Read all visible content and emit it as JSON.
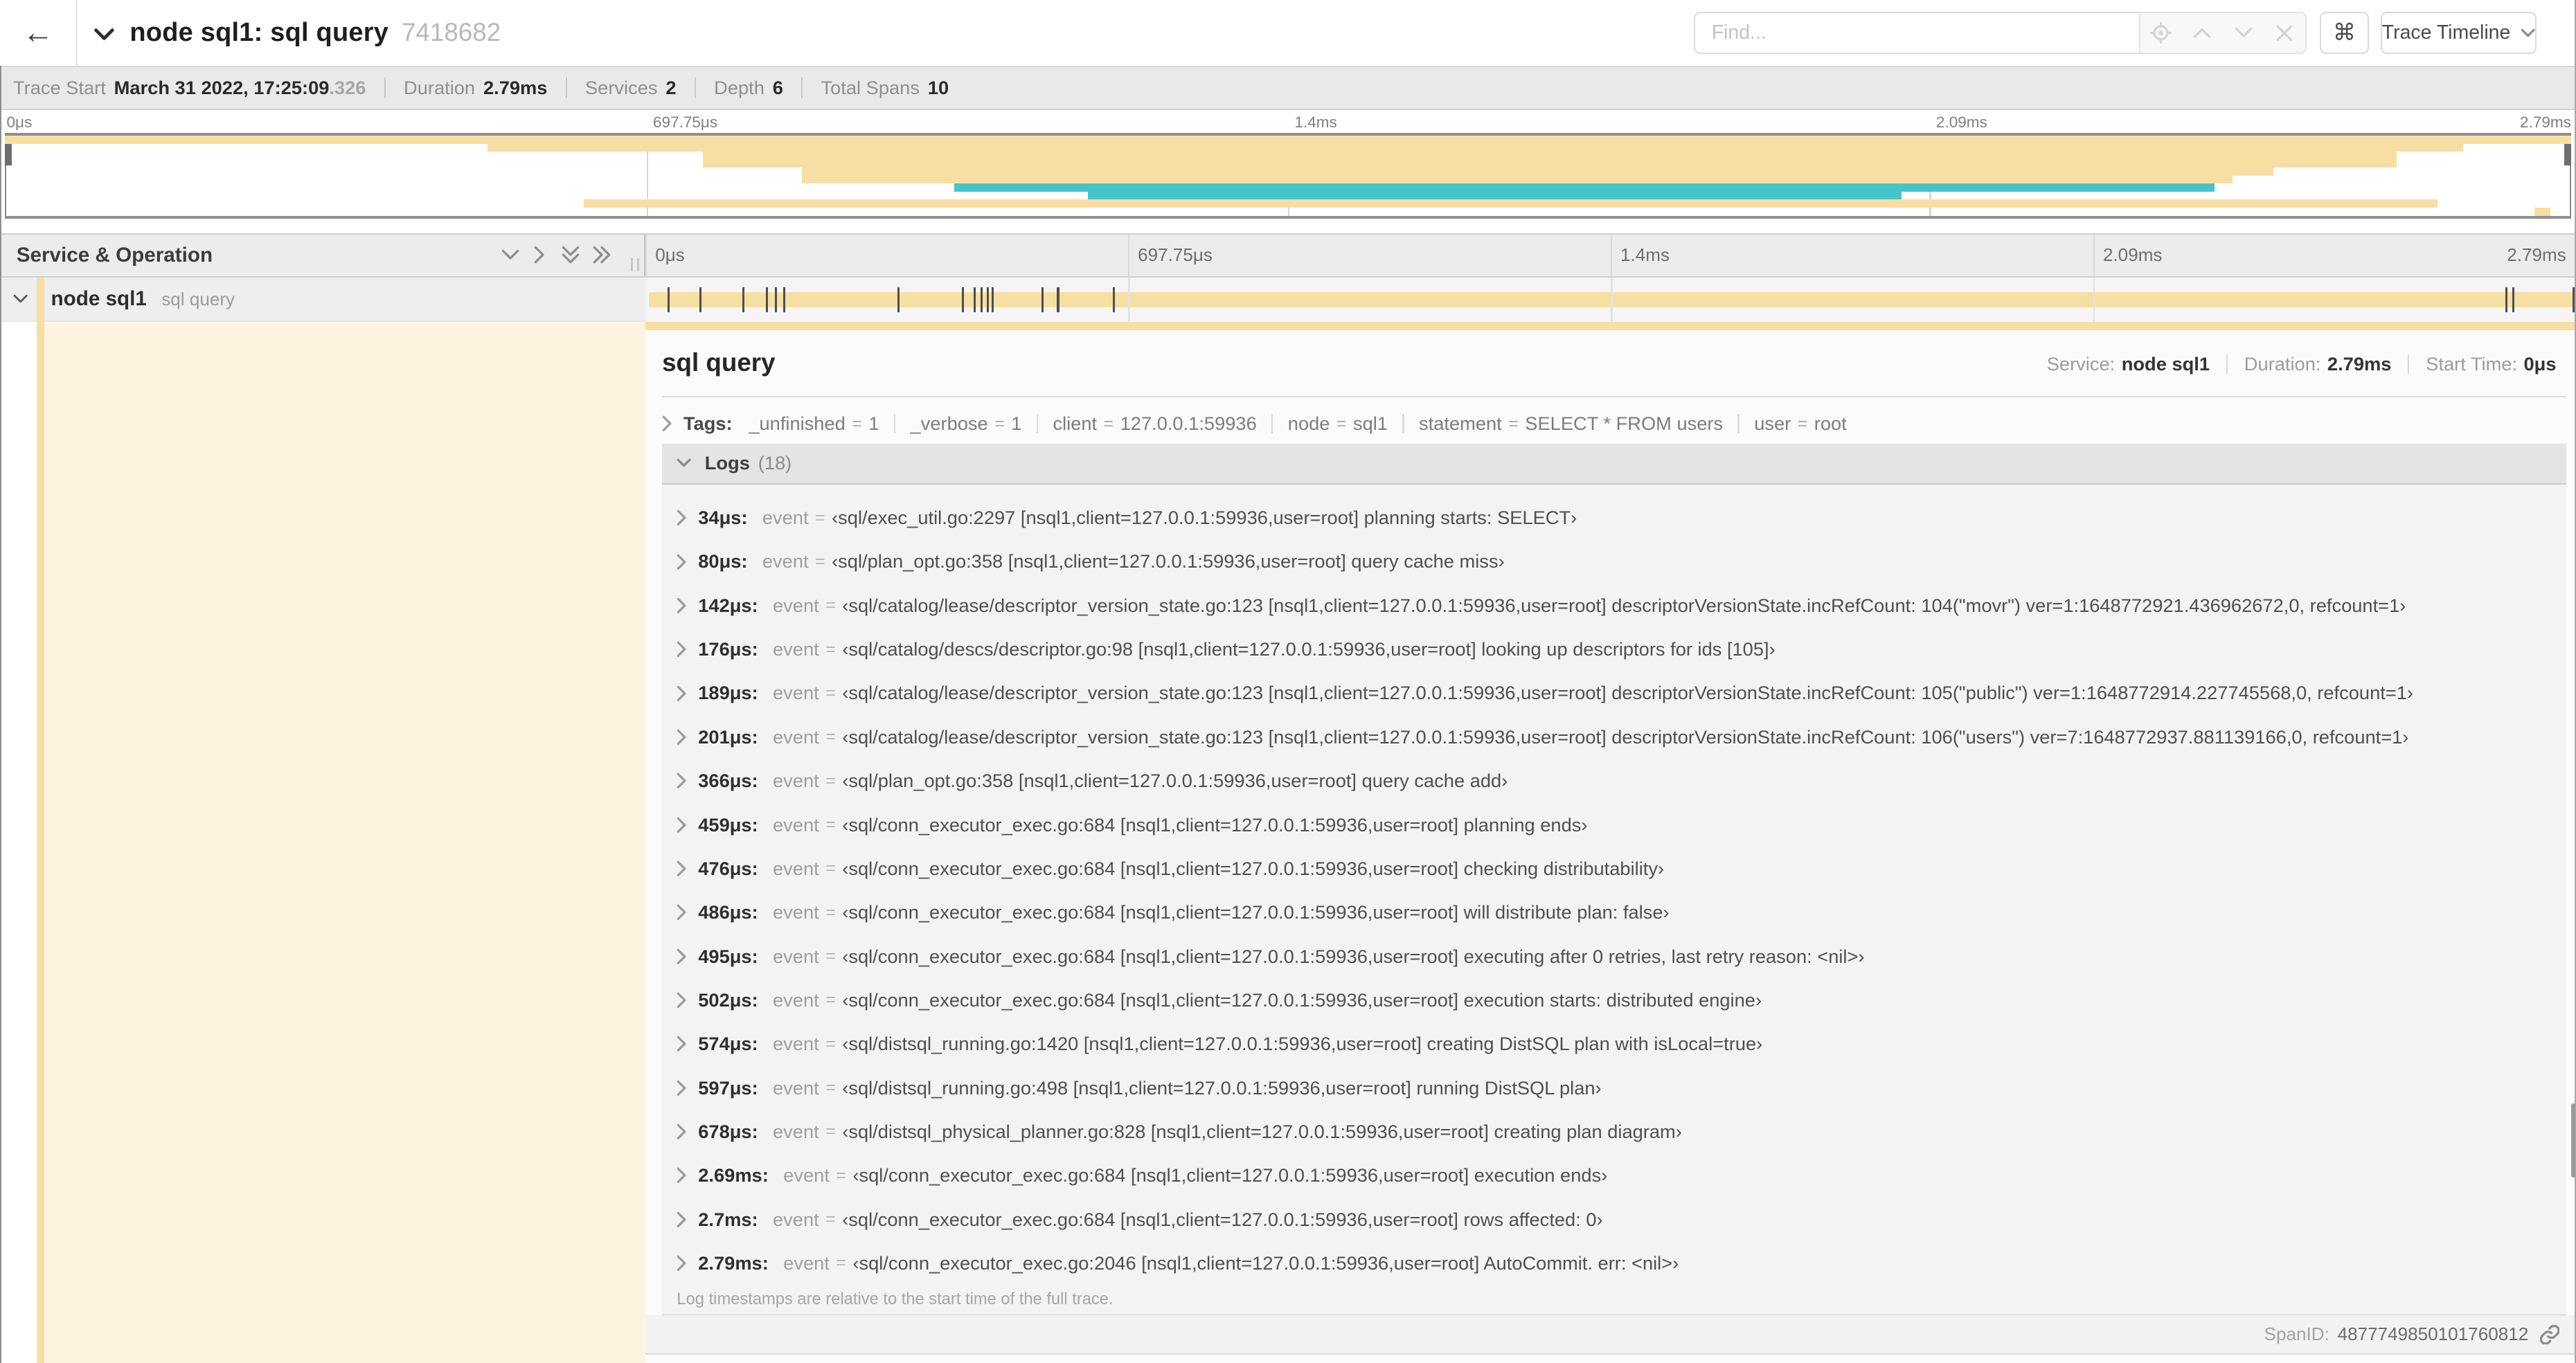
{
  "header": {
    "back_arrow": "←",
    "title": "node sql1: sql query",
    "trace_id": "7418682",
    "find_placeholder": "Find...",
    "shortcut_key": "⌘",
    "view_button_label": "Trace Timeline"
  },
  "stats": {
    "items": [
      {
        "label": "Trace Start",
        "value": "March 31 2022, 17:25:09",
        "suffix": ".326"
      },
      {
        "label": "Duration",
        "value": "2.79ms"
      },
      {
        "label": "Services",
        "value": "2"
      },
      {
        "label": "Depth",
        "value": "6"
      },
      {
        "label": "Total Spans",
        "value": "10"
      }
    ]
  },
  "timeline": {
    "axis_labels": [
      "0μs",
      "697.75μs",
      "1.4ms",
      "2.09ms",
      "2.79ms"
    ],
    "colors": {
      "yellow": "#f7dfa4",
      "teal": "#45c5c9",
      "pale": "#fcf4df"
    },
    "minimap_rows": [
      {
        "start": 0.0,
        "end": 1.0,
        "color": "yellow"
      },
      {
        "start": 0.188,
        "end": 0.958,
        "color": "yellow"
      },
      {
        "start": 0.272,
        "end": 0.932,
        "color": "yellow"
      },
      {
        "start": 0.272,
        "end": 0.932,
        "color": "yellow"
      },
      {
        "start": 0.3105,
        "end": 0.884,
        "color": "yellow"
      },
      {
        "start": 0.3105,
        "end": 0.868,
        "color": "yellow"
      },
      {
        "start": 0.37,
        "end": 0.861,
        "color": "teal"
      },
      {
        "start": 0.422,
        "end": 0.739,
        "color": "teal"
      },
      {
        "start": 0.2255,
        "end": 0.948,
        "color": "yellow"
      },
      {
        "start": 0.9858,
        "end": 0.992,
        "color": "yellow"
      }
    ]
  },
  "columns": {
    "left_title": "Service & Operation"
  },
  "span_row": {
    "service": "node sql1",
    "operation": "sql query",
    "duration_us": 2790,
    "log_times_us": [
      34,
      80,
      142,
      176,
      189,
      201,
      366,
      459,
      476,
      486,
      495,
      502,
      574,
      597,
      678,
      2690,
      2700,
      2790
    ]
  },
  "detail": {
    "title": "sql query",
    "meta": [
      {
        "label": "Service:",
        "value": "node sql1"
      },
      {
        "label": "Duration:",
        "value": "2.79ms"
      },
      {
        "label": "Start Time:",
        "value": "0μs"
      }
    ],
    "tags_label": "Tags:",
    "tags": [
      {
        "key": "_unfinished",
        "value": "1"
      },
      {
        "key": "_verbose",
        "value": "1"
      },
      {
        "key": "client",
        "value": "127.0.0.1:59936"
      },
      {
        "key": "node",
        "value": "sql1"
      },
      {
        "key": "statement",
        "value": "SELECT * FROM users"
      },
      {
        "key": "user",
        "value": "root"
      }
    ],
    "logs": {
      "title": "Logs",
      "count": "(18)",
      "field_name": "event",
      "entries": [
        {
          "time": "34μs:",
          "value": "‹sql/exec_util.go:2297 [nsql1,client=127.0.0.1:59936,user=root] planning starts: SELECT›"
        },
        {
          "time": "80μs:",
          "value": "‹sql/plan_opt.go:358 [nsql1,client=127.0.0.1:59936,user=root] query cache miss›"
        },
        {
          "time": "142μs:",
          "value": "‹sql/catalog/lease/descriptor_version_state.go:123 [nsql1,client=127.0.0.1:59936,user=root] descriptorVersionState.incRefCount: 104(\"movr\") ver=1:1648772921.436962672,0, refcount=1›"
        },
        {
          "time": "176μs:",
          "value": "‹sql/catalog/descs/descriptor.go:98 [nsql1,client=127.0.0.1:59936,user=root] looking up descriptors for ids [105]›"
        },
        {
          "time": "189μs:",
          "value": "‹sql/catalog/lease/descriptor_version_state.go:123 [nsql1,client=127.0.0.1:59936,user=root] descriptorVersionState.incRefCount: 105(\"public\") ver=1:1648772914.227745568,0, refcount=1›"
        },
        {
          "time": "201μs:",
          "value": "‹sql/catalog/lease/descriptor_version_state.go:123 [nsql1,client=127.0.0.1:59936,user=root] descriptorVersionState.incRefCount: 106(\"users\") ver=7:1648772937.881139166,0, refcount=1›"
        },
        {
          "time": "366μs:",
          "value": "‹sql/plan_opt.go:358 [nsql1,client=127.0.0.1:59936,user=root] query cache add›"
        },
        {
          "time": "459μs:",
          "value": "‹sql/conn_executor_exec.go:684 [nsql1,client=127.0.0.1:59936,user=root] planning ends›"
        },
        {
          "time": "476μs:",
          "value": "‹sql/conn_executor_exec.go:684 [nsql1,client=127.0.0.1:59936,user=root] checking distributability›"
        },
        {
          "time": "486μs:",
          "value": "‹sql/conn_executor_exec.go:684 [nsql1,client=127.0.0.1:59936,user=root] will distribute plan: false›"
        },
        {
          "time": "495μs:",
          "value": "‹sql/conn_executor_exec.go:684 [nsql1,client=127.0.0.1:59936,user=root] executing after 0 retries, last retry reason: <nil>›"
        },
        {
          "time": "502μs:",
          "value": "‹sql/conn_executor_exec.go:684 [nsql1,client=127.0.0.1:59936,user=root] execution starts: distributed engine›"
        },
        {
          "time": "574μs:",
          "value": "‹sql/distsql_running.go:1420 [nsql1,client=127.0.0.1:59936,user=root] creating DistSQL plan with isLocal=true›"
        },
        {
          "time": "597μs:",
          "value": "‹sql/distsql_running.go:498 [nsql1,client=127.0.0.1:59936,user=root] running DistSQL plan›"
        },
        {
          "time": "678μs:",
          "value": "‹sql/distsql_physical_planner.go:828 [nsql1,client=127.0.0.1:59936,user=root] creating plan diagram›"
        },
        {
          "time": "2.69ms:",
          "value": "‹sql/conn_executor_exec.go:684 [nsql1,client=127.0.0.1:59936,user=root] execution ends›"
        },
        {
          "time": "2.7ms:",
          "value": "‹sql/conn_executor_exec.go:684 [nsql1,client=127.0.0.1:59936,user=root] rows affected: 0›"
        },
        {
          "time": "2.79ms:",
          "value": "‹sql/conn_executor_exec.go:2046 [nsql1,client=127.0.0.1:59936,user=root] AutoCommit. err: <nil>›"
        }
      ],
      "footnote": "Log timestamps are relative to the start time of the full trace."
    },
    "span_id_label": "SpanID:",
    "span_id": "4877749850101760812"
  }
}
